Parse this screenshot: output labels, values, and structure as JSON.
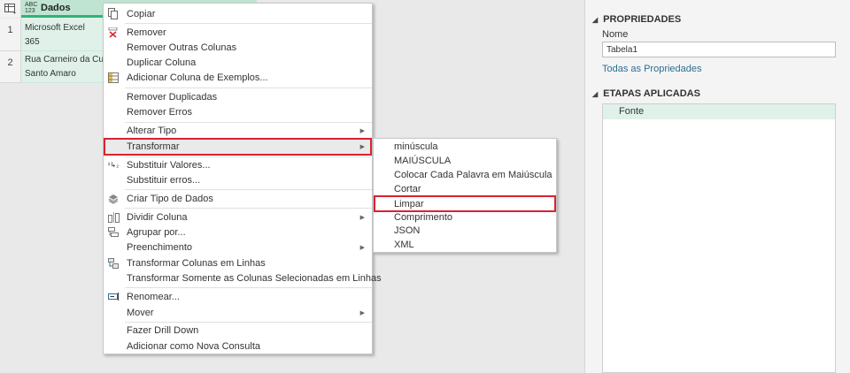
{
  "grid": {
    "column_type": "ABC\n123",
    "column_title": "Dados",
    "rows": [
      {
        "num": "1",
        "line1": "Microsoft Excel",
        "line2": "365"
      },
      {
        "num": "2",
        "line1": "Rua Carneiro da Cunha",
        "line2": "Santo Amaro"
      }
    ]
  },
  "menu": {
    "items": [
      {
        "label": "Copiar",
        "icon": "copy-icon"
      },
      {
        "label": "Remover",
        "icon": "remove-icon"
      },
      {
        "label": "Remover Outras Colunas"
      },
      {
        "label": "Duplicar Coluna"
      },
      {
        "label": "Adicionar Coluna de Exemplos...",
        "icon": "add-column-example-icon"
      },
      {
        "label": "Remover Duplicadas"
      },
      {
        "label": "Remover Erros"
      },
      {
        "label": "Alterar Tipo"
      },
      {
        "label": "Transformar"
      },
      {
        "label": "Substituir Valores...",
        "icon": "replace-values-icon"
      },
      {
        "label": "Substituir erros..."
      },
      {
        "label": "Criar Tipo de Dados",
        "icon": "data-type-icon"
      },
      {
        "label": "Dividir Coluna",
        "icon": "split-column-icon"
      },
      {
        "label": "Agrupar por...",
        "icon": "group-by-icon"
      },
      {
        "label": "Preenchimento"
      },
      {
        "label": "Transformar Colunas em Linhas",
        "icon": "unpivot-icon"
      },
      {
        "label": "Transformar Somente as Colunas Selecionadas em Linhas"
      },
      {
        "label": "Renomear...",
        "icon": "rename-icon"
      },
      {
        "label": "Mover"
      },
      {
        "label": "Fazer Drill Down"
      },
      {
        "label": "Adicionar como Nova Consulta"
      }
    ]
  },
  "submenu": {
    "items": [
      "minúscula",
      "MAIÚSCULA",
      "Colocar Cada Palavra em Maiúscula",
      "Cortar",
      "Limpar",
      "Comprimento",
      "JSON",
      "XML"
    ]
  },
  "panel": {
    "properties_title": "PROPRIEDADES",
    "name_label": "Nome",
    "name_value": "Tabela1",
    "all_properties": "Todas as Propriedades",
    "steps_title": "ETAPAS APLICADAS",
    "steps": [
      "Fonte"
    ]
  },
  "colors": {
    "accent_green": "#2fb37a",
    "selection_green": "#dff1e8",
    "highlight_red": "#d9232f",
    "link_blue": "#2a6f97"
  }
}
